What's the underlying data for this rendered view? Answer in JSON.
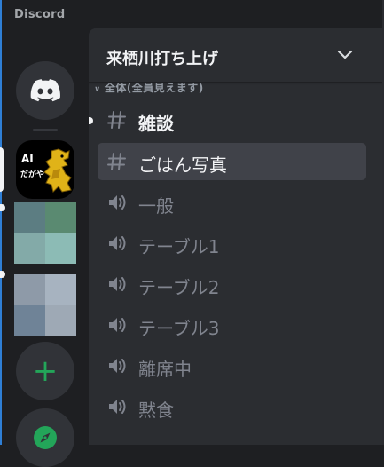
{
  "app": {
    "title": "Discord"
  },
  "server": {
    "name": "来栖川打ち上げ"
  },
  "category": {
    "label": "全体(全員見えます)"
  },
  "servers": {
    "ai_icon": {
      "line1": "AI",
      "line2": "だがや"
    }
  },
  "channels": [
    {
      "name": "雑談",
      "type": "text",
      "state": "unread"
    },
    {
      "name": "ごはん写真",
      "type": "text",
      "state": "selected"
    },
    {
      "name": "一般",
      "type": "voice",
      "state": "normal"
    },
    {
      "name": "テーブル1",
      "type": "voice",
      "state": "normal"
    },
    {
      "name": "テーブル2",
      "type": "voice",
      "state": "normal"
    },
    {
      "name": "テーブル3",
      "type": "voice",
      "state": "normal"
    },
    {
      "name": "離席中",
      "type": "voice",
      "state": "normal"
    },
    {
      "name": "黙食",
      "type": "voice",
      "state": "normal"
    }
  ],
  "icons": {
    "home": "discord-logo-icon",
    "add": "plus-icon",
    "explore": "compass-icon",
    "text_channel": "hashtag-icon",
    "voice_channel": "speaker-icon",
    "dropdown": "chevron-down-icon"
  },
  "colors": {
    "accent_green": "#23a559",
    "selected_bg": "#404249",
    "panel_bg": "#2b2d31",
    "rail_bg": "#1e1f22"
  }
}
